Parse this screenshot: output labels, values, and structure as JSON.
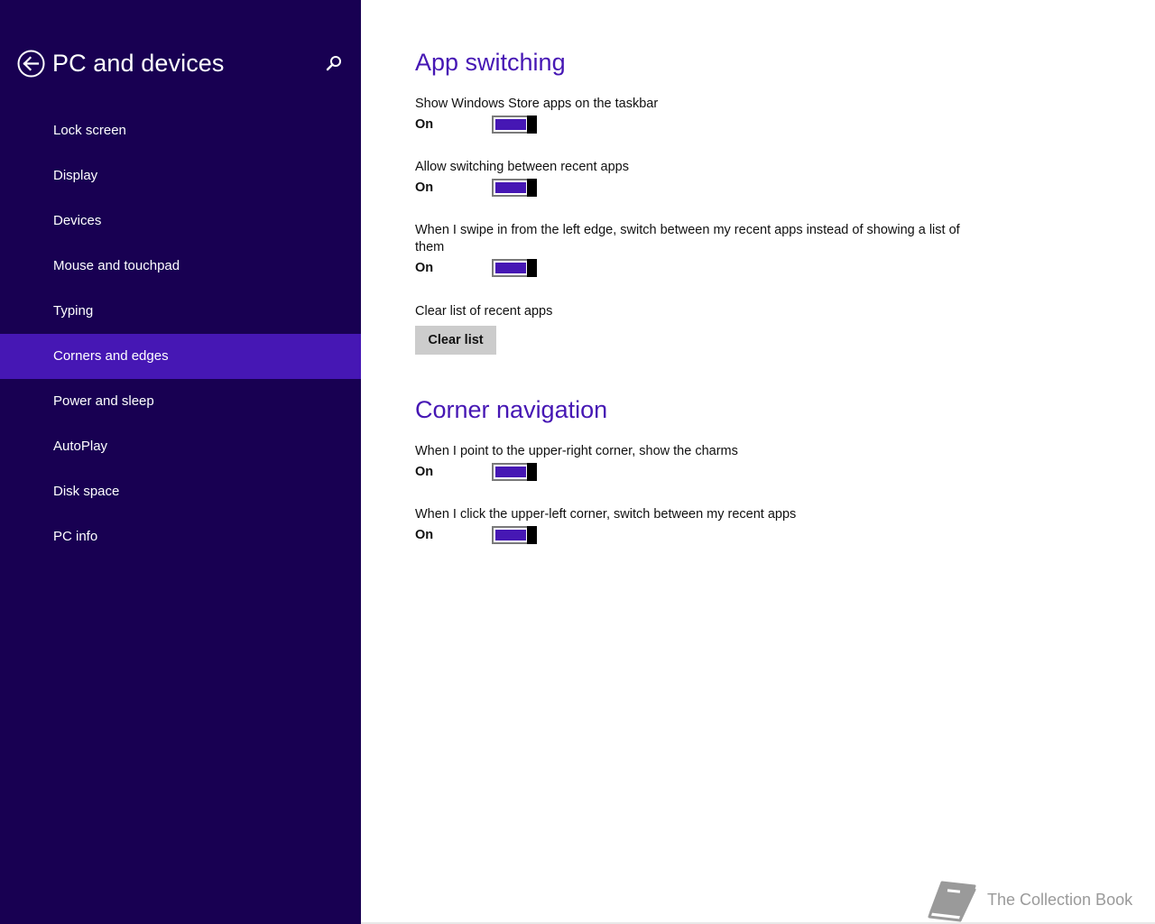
{
  "sidebar": {
    "title": "PC and devices",
    "back_icon": "back-arrow-circle-icon",
    "search_icon": "search-icon",
    "items": [
      {
        "label": "Lock screen",
        "selected": false
      },
      {
        "label": "Display",
        "selected": false
      },
      {
        "label": "Devices",
        "selected": false
      },
      {
        "label": "Mouse and touchpad",
        "selected": false
      },
      {
        "label": "Typing",
        "selected": false
      },
      {
        "label": "Corners and edges",
        "selected": true
      },
      {
        "label": "Power and sleep",
        "selected": false
      },
      {
        "label": "AutoPlay",
        "selected": false
      },
      {
        "label": "Disk space",
        "selected": false
      },
      {
        "label": "PC info",
        "selected": false
      }
    ]
  },
  "main": {
    "app_switching": {
      "title": "App switching",
      "settings": [
        {
          "label": "Show Windows Store apps on the taskbar",
          "state": "On",
          "on": true
        },
        {
          "label": "Allow switching between recent apps",
          "state": "On",
          "on": true
        },
        {
          "label": "When I swipe in from the left edge, switch between my recent apps instead of showing a list of them",
          "state": "On",
          "on": true
        }
      ],
      "clear": {
        "label": "Clear list of recent apps",
        "button": "Clear list"
      }
    },
    "corner_navigation": {
      "title": "Corner navigation",
      "settings": [
        {
          "label": "When I point to the upper-right corner, show the charms",
          "state": "On",
          "on": true
        },
        {
          "label": "When I click the upper-left corner, switch between my recent apps",
          "state": "On",
          "on": true
        }
      ]
    }
  },
  "watermark": {
    "text": "The Collection Book",
    "icon": "book-icon"
  },
  "colors": {
    "sidebar_bg": "#180052",
    "accent": "#4617b4",
    "toggle_thumb": "#000000",
    "button_bg": "#cccccc"
  }
}
